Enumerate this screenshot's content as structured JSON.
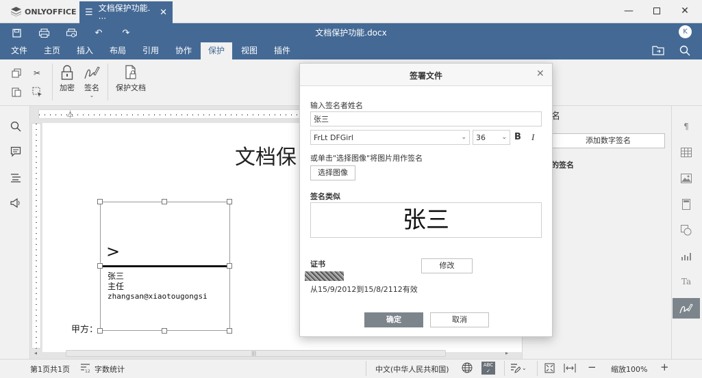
{
  "app": {
    "brand": "ONLYOFFICE",
    "tab_title": "文档保护功能. ···",
    "doc_title": "文档保护功能.docx",
    "avatar": "K"
  },
  "menu": {
    "tabs": [
      "文件",
      "主页",
      "插入",
      "布局",
      "引用",
      "协作",
      "保护",
      "视图",
      "插件"
    ],
    "active": "保护"
  },
  "toolbar": {
    "encrypt_label": "加密",
    "signature_label": "签名",
    "protect_label": "保护文档"
  },
  "document": {
    "heading": "文档保",
    "sig_name": "张三",
    "sig_title": "主任",
    "sig_email": "zhangsan@xiaotougongsi",
    "party_label": "甲方："
  },
  "right_panel": {
    "title_fragment": "名",
    "add_digital_signature": "添加数字签名",
    "section_fragment": "的签名"
  },
  "dialog": {
    "title": "签署文件",
    "signer_name_label": "输入签名者姓名",
    "signer_name_value": "张三",
    "font_name": "FrLt DFGirl",
    "font_size": "36",
    "bold_label": "B",
    "italic_label": "I",
    "image_hint": "或单击\"选择图像\"将图片用作签名",
    "choose_image": "选择图像",
    "preview_label": "签名类似",
    "preview_text": "张三",
    "cert_label": "证书",
    "modify_button": "修改",
    "validity": "从15/9/2012到15/8/2112有效",
    "ok_button": "确定",
    "cancel_button": "取消"
  },
  "statusbar": {
    "page_info": "第1页共1页",
    "word_count": "字数统计",
    "language": "中文(中华人民共和国)",
    "zoom": "缩放100%"
  },
  "colors": {
    "brand_blue": "#446995",
    "panel_grey": "#f1f1f1",
    "primary_button": "#7d858c"
  }
}
